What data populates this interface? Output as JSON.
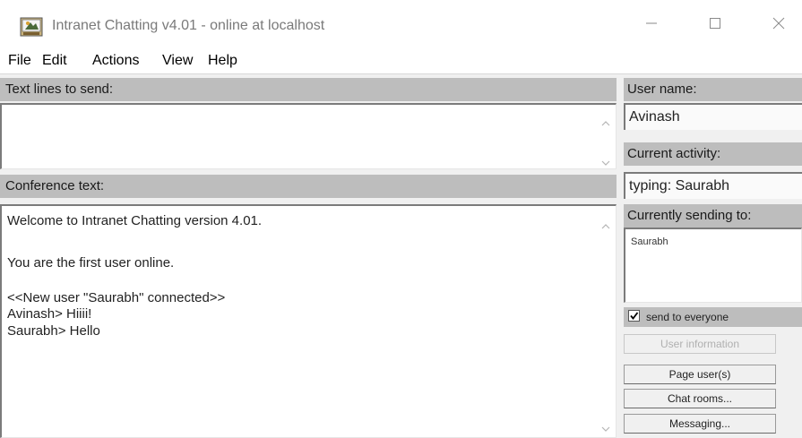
{
  "window": {
    "title": "Intranet Chatting v4.01 - online at localhost"
  },
  "menu": {
    "items": [
      "File",
      "Edit",
      "Actions",
      "View",
      "Help"
    ]
  },
  "left": {
    "send_header": "Text lines to send:",
    "send_value": "",
    "conference_header": "Conference text:",
    "conference_lines": [
      "Welcome to Intranet Chatting version 4.01.",
      "You are the first user online.",
      "<<New user \"Saurabh\" connected>>",
      "Avinash> Hiiii!",
      "Saurabh> Hello"
    ]
  },
  "right": {
    "user_name_label": "User name:",
    "user_name_value": "Avinash",
    "activity_label": "Current activity:",
    "activity_value": "typing: Saurabh",
    "sending_to_label": "Currently sending to:",
    "recipients": [
      "Saurabh"
    ],
    "send_everyone_label": "send to everyone",
    "send_everyone_checked": true,
    "buttons": {
      "user_information": "User information",
      "page_users": "Page user(s)",
      "chat_rooms": "Chat rooms...",
      "messaging": "Messaging..."
    }
  },
  "icons": {
    "app": "chat-app-icon",
    "minimize": "minimize-icon",
    "maximize": "maximize-icon",
    "close": "close-icon",
    "scroll_up": "scroll-up-icon",
    "scroll_down": "scroll-down-icon",
    "check": "checkmark-icon"
  }
}
